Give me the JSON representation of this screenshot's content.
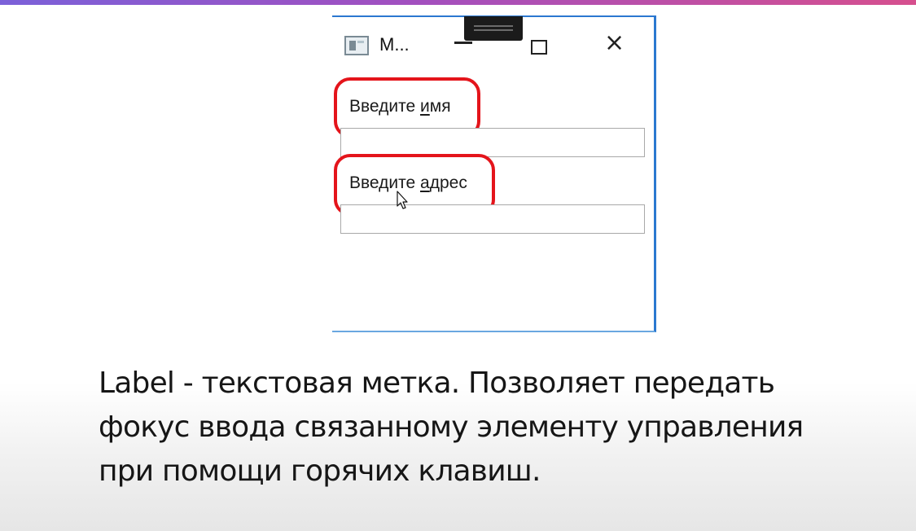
{
  "window": {
    "title": "M...",
    "close_glyph": "×",
    "labels": [
      {
        "before": "Введите ",
        "access_key": "и",
        "after": "мя"
      },
      {
        "before": "Введите ",
        "access_key": "а",
        "after": "дрес"
      }
    ],
    "fields": [
      {
        "value": "",
        "placeholder": ""
      },
      {
        "value": "",
        "placeholder": ""
      }
    ],
    "highlight_color": "#e4141b",
    "accent_color": "#2b78d0"
  },
  "icons": {
    "app": "window-app-icon",
    "minimize": "minimize-icon",
    "maximize": "maximize-icon",
    "close": "close-icon",
    "cursor": "mouse-cursor-icon"
  },
  "caption": {
    "lines": [
      "Label - текстовая метка. Позволяет передать",
      "фокус ввода связанному элементу управления",
      "при помощи горячих клавиш."
    ]
  },
  "theme": {
    "top_bar_gradient": [
      "#7b61d9",
      "#d64f8e"
    ]
  }
}
